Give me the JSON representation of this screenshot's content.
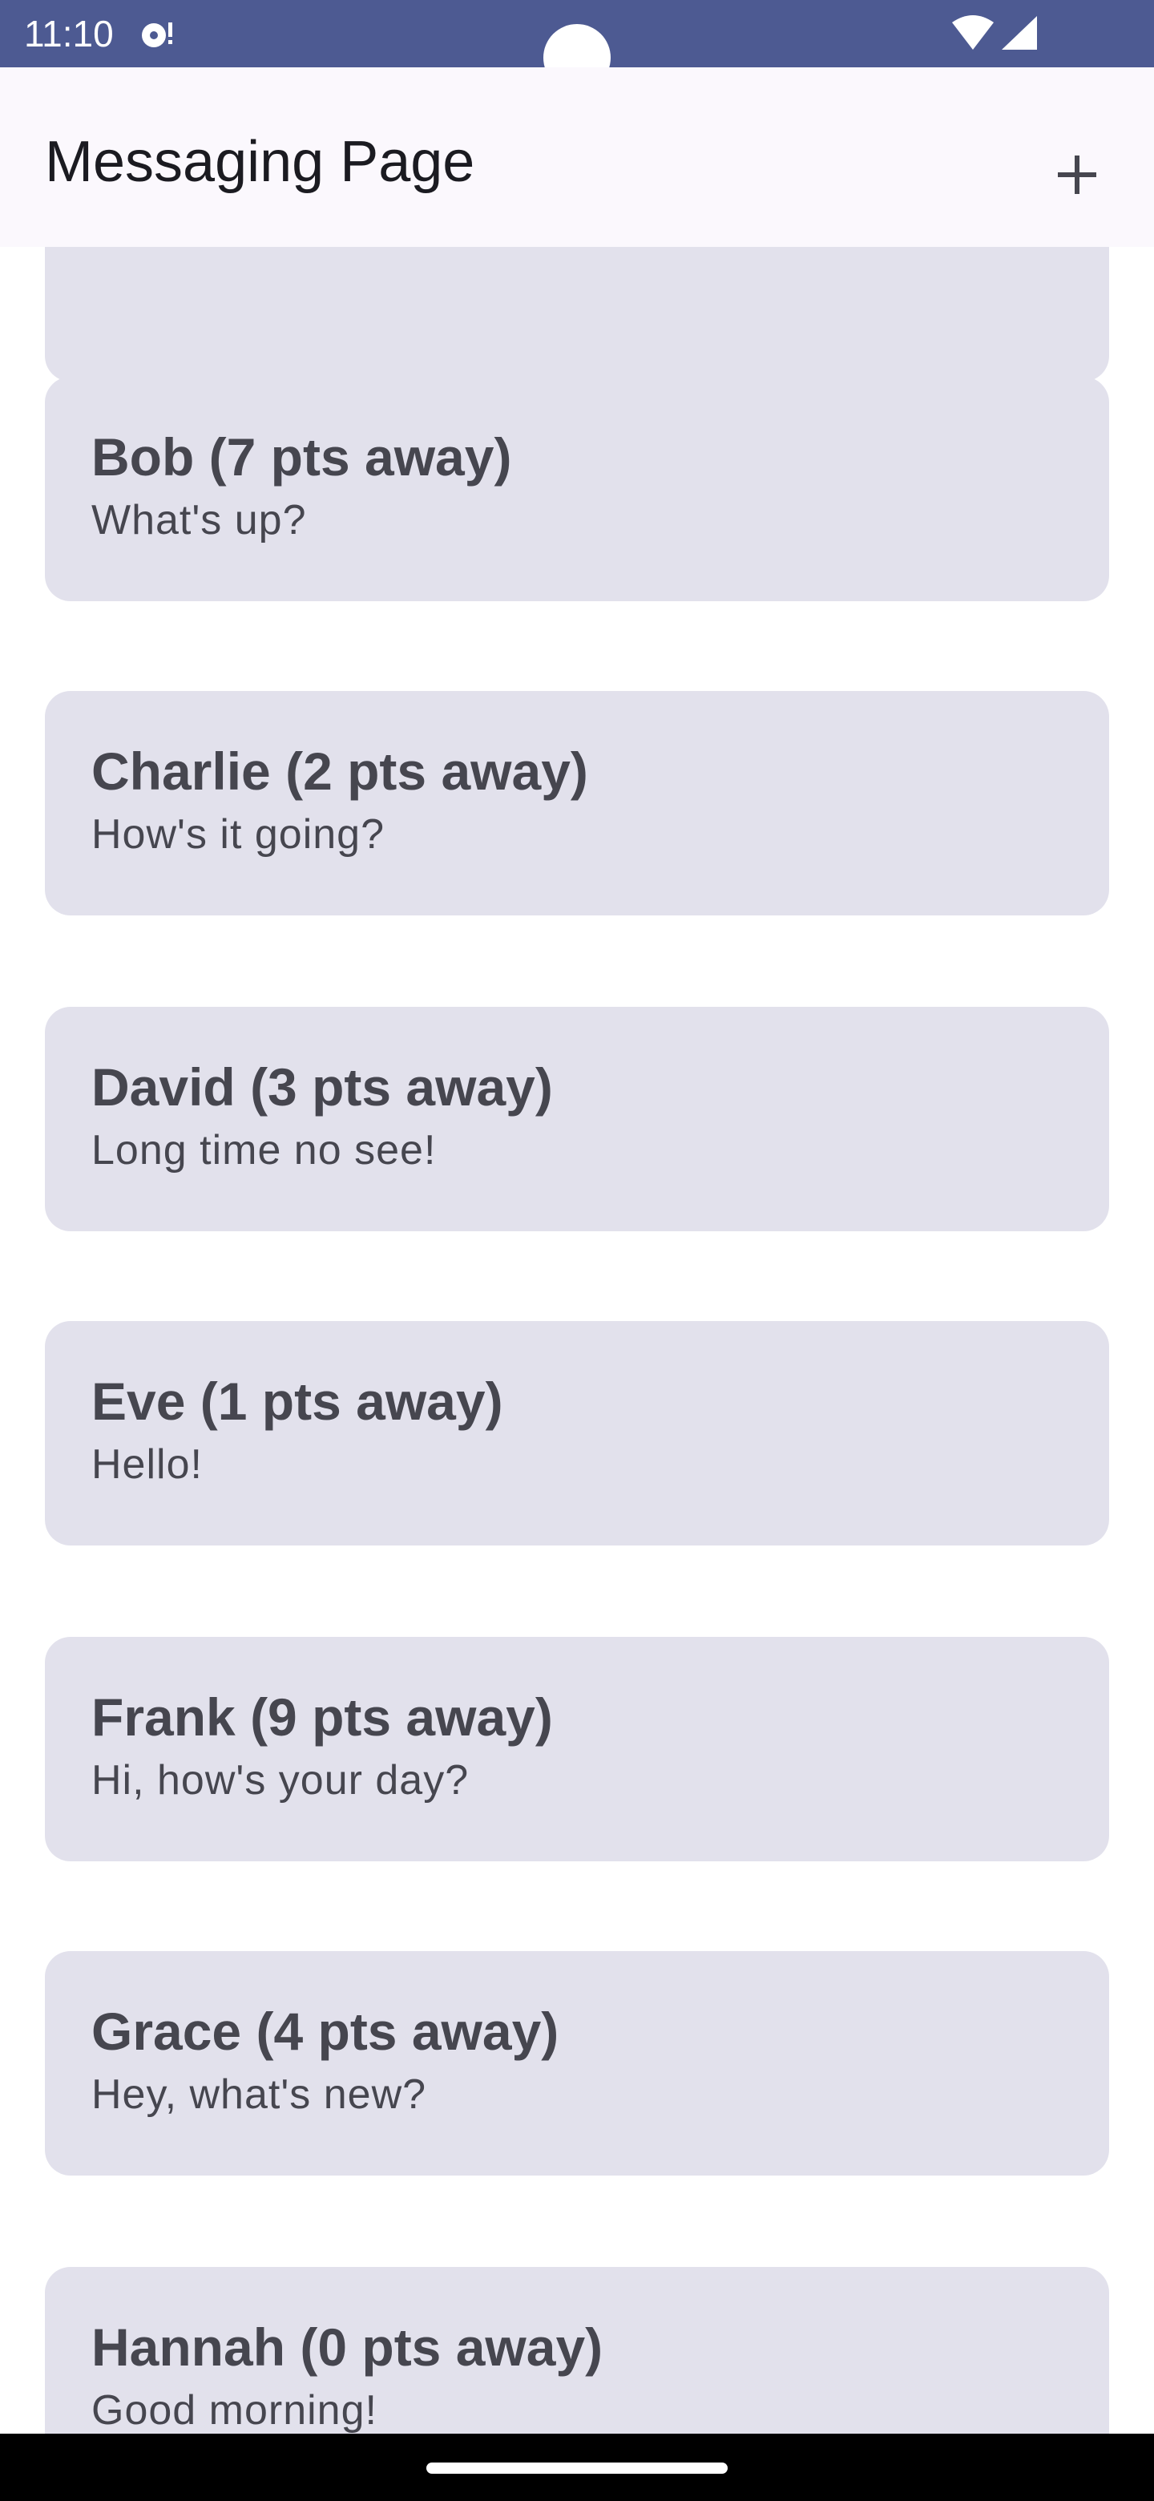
{
  "status_bar": {
    "time": "11:10",
    "icons": [
      "notification-icon",
      "wifi-icon",
      "signal-icon"
    ]
  },
  "app_bar": {
    "title": "Messaging Page",
    "add_icon": "plus-icon"
  },
  "conversations": [
    {
      "name": "",
      "message": ""
    },
    {
      "name": "Bob (7 pts away)",
      "message": "What's up?"
    },
    {
      "name": "Charlie (2 pts away)",
      "message": "How's it going?"
    },
    {
      "name": "David (3 pts away)",
      "message": "Long time no see!"
    },
    {
      "name": "Eve (1 pts away)",
      "message": "Hello!"
    },
    {
      "name": "Frank (9 pts away)",
      "message": "Hi, how's your day?"
    },
    {
      "name": "Grace (4 pts away)",
      "message": "Hey, what's new?"
    },
    {
      "name": "Hannah (0 pts away)",
      "message": "Good morning!"
    }
  ],
  "colors": {
    "status_bar": "#4d5a92",
    "app_bar": "#fbf8fd",
    "card": "#e2e1ec",
    "card_text": "#46464f",
    "title_text": "#1b1b21",
    "nav_bar": "#000000"
  }
}
